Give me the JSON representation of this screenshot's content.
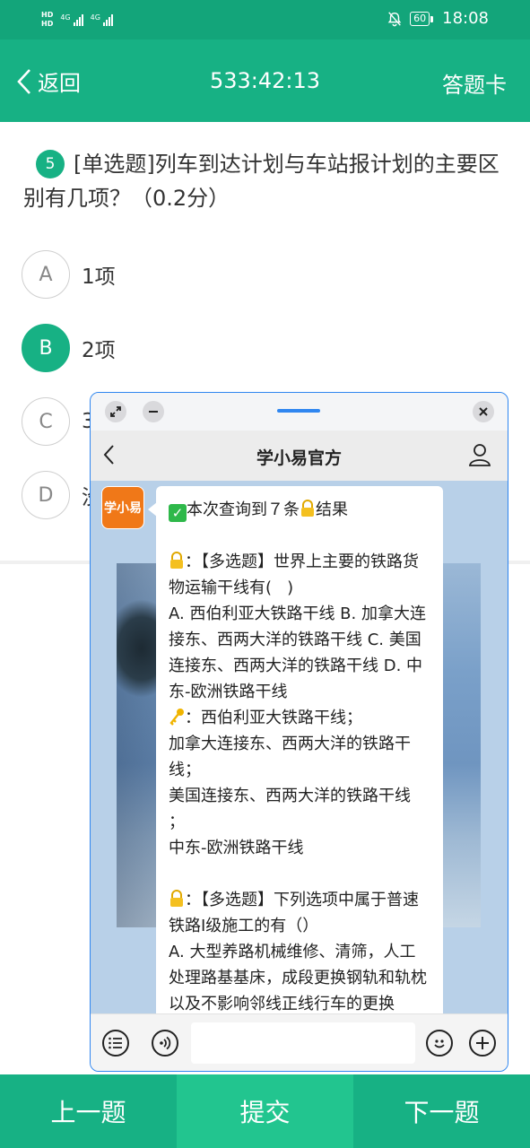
{
  "status_bar": {
    "hd_top": "HD",
    "hd_bottom": "HD",
    "net1": "4G",
    "net2": "4G",
    "battery": "60",
    "time": "18:08",
    "icons": [
      "mute-bell-icon",
      "battery-icon",
      "signal-icon"
    ]
  },
  "header": {
    "back_label": "返回",
    "timer": "533:42:13",
    "answer_card_label": "答题卡",
    "color": "#17b184"
  },
  "question": {
    "number": "5",
    "text": "[单选题]列车到达计划与车站报计划的主要区别有几项？（0.2分）",
    "options": [
      {
        "letter": "A",
        "text": "1项",
        "selected": false
      },
      {
        "letter": "B",
        "text": "2项",
        "selected": true
      },
      {
        "letter": "C",
        "text": "3",
        "selected": false
      },
      {
        "letter": "D",
        "text": "没",
        "selected": false
      }
    ]
  },
  "bottom_bar": {
    "prev_label": "上一题",
    "submit_label": "提交",
    "next_label": "下一题"
  },
  "chat_window": {
    "title": "学小易官方",
    "avatar_label": "学小易",
    "message": {
      "summary": "本次查询到７条",
      "summary_tail": "结果",
      "q1_head": "：【多选题】世界上主要的铁路货物运输干线有(   )",
      "q1_options": "A. 西伯利亚大铁路干线 B. 加拿大连接东、西两大洋的铁路干线 C. 美国连接东、西两大洋的铁路干线 D. 中东-欧洲铁路干线",
      "q1_answer": "：西伯利亚大铁路干线；\n加拿大连接东、西两大洋的铁路干线；\n美国连接东、西两大洋的铁路干线\n；\n中东-欧洲铁路干线",
      "q2_head": "：【多选题】下列选项中属于普速铁路Ⅰ级施工的有（）",
      "q2_options": "A. 大型养路机械维修、清筛，人工处理路基基床，成段更换钢轨和轨枕以及不影响邻线正线行车的更换"
    },
    "icons": [
      "collapse-icon",
      "minimize-icon",
      "close-icon",
      "back-icon",
      "user-icon",
      "list-icon",
      "voice-icon",
      "emoji-icon",
      "plus-icon",
      "key-icon",
      "lock-icon",
      "check-icon"
    ]
  }
}
